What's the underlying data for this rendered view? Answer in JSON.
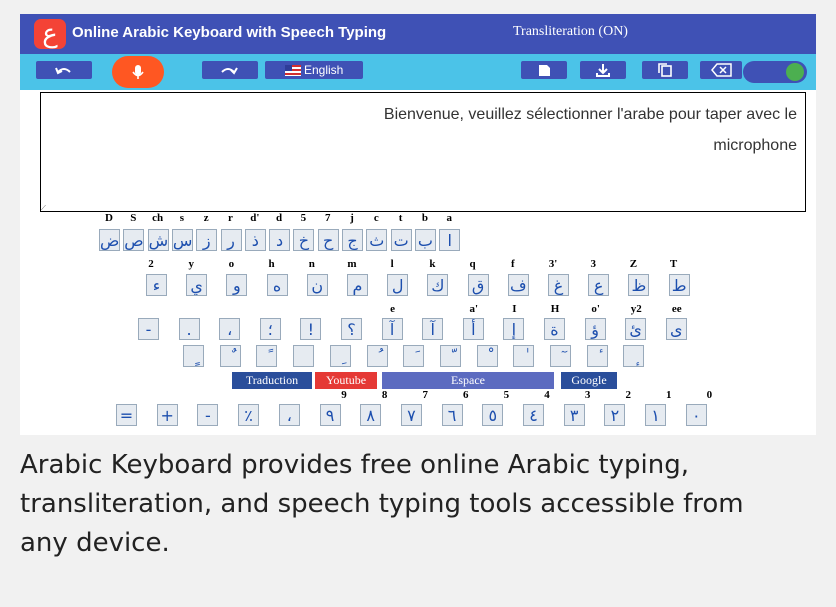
{
  "header": {
    "logo_char": "ع",
    "title": "Online Arabic Keyboard with Speech Typing",
    "transliteration": "Transliteration (ON)"
  },
  "toolbar": {
    "undo_icon": "undo-icon",
    "mic_icon": "microphone-icon",
    "redo_icon": "redo-icon",
    "language_label": "English",
    "language_flag": "us-flag-icon",
    "new_icon": "new-file-icon",
    "download_icon": "download-icon",
    "copy_icon": "copy-icon",
    "backspace_icon": "backspace-icon",
    "toggle_state": "on"
  },
  "editor": {
    "text_line1": "Bienvenue, veuillez sélectionner l'arabe pour taper avec le",
    "text_line2": "microphone"
  },
  "keyboard": {
    "row1_labels": [
      "D",
      "S",
      "ch",
      "s",
      "z",
      "r",
      "d'",
      "d",
      "5",
      "7",
      "j",
      "c",
      "t",
      "b",
      "a"
    ],
    "row1_keys": [
      "ض",
      "ص",
      "ش",
      "س",
      "ز",
      "ر",
      "ذ",
      "د",
      "خ",
      "ح",
      "ج",
      "ث",
      "ت",
      "ب",
      "ا"
    ],
    "row2_labels": [
      "2",
      "y",
      "o",
      "h",
      "n",
      "m",
      "l",
      "k",
      "q",
      "f",
      "3'",
      "3",
      "Z",
      "T"
    ],
    "row2_keys": [
      "ء",
      "ي",
      "و",
      "ه",
      "ن",
      "م",
      "ل",
      "ك",
      "ق",
      "ف",
      "غ",
      "ع",
      "ظ",
      "ط"
    ],
    "row3_labels": [
      "",
      "",
      "",
      "",
      "",
      "",
      "e",
      "",
      "a'",
      "I",
      "H",
      "o'",
      "y2",
      "ee"
    ],
    "row3_keys": [
      "-",
      ".",
      "،",
      "؛",
      "!",
      "؟",
      "آ",
      "آ",
      "أ",
      "إ",
      "ة",
      "ؤ",
      "ئ",
      "ى"
    ],
    "row4_keys": [
      "ٍ",
      "ٌ",
      "ً",
      "",
      "ِ",
      "ُ",
      "َ",
      "ّ",
      "ْ",
      "ٰ",
      "ٓ",
      "ٔ",
      "ٕ"
    ],
    "special": {
      "translate": "Traduction",
      "youtube": "Youtube",
      "space": "Espace",
      "google": "Google"
    },
    "digit_labels": [
      "9",
      "8",
      "7",
      "6",
      "5",
      "4",
      "3",
      "2",
      "1",
      "0"
    ],
    "digit_keys": [
      "=",
      "+",
      "-",
      "٪",
      "،",
      "٩",
      "٨",
      "٧",
      "٦",
      "٥",
      "٤",
      "٣",
      "٢",
      "١",
      "٠"
    ]
  },
  "description": "Arabic Keyboard provides free online Arabic typing, transliteration, and speech typing tools accessible from any device.",
  "colors": {
    "header": "#3f51b5",
    "toolbar": "#4bc3e8",
    "mic": "#ff5722",
    "logo": "#f44336",
    "toggle_knob": "#4caf50",
    "youtube": "#e53935",
    "space": "#5c6bc0",
    "translate": "#2a4e9b"
  }
}
